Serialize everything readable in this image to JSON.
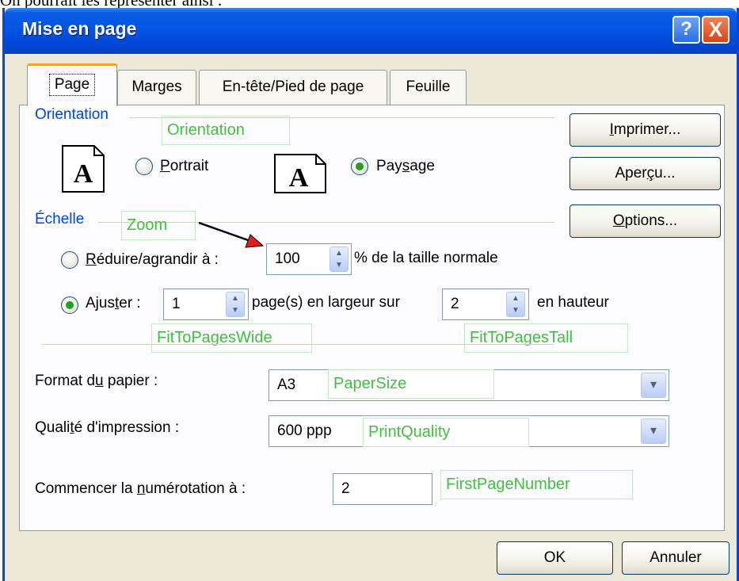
{
  "caption": "On pourrait les représenter ainsi :",
  "window": {
    "title": "Mise en page",
    "help_symbol": "?",
    "close_symbol": "X"
  },
  "tabs": [
    {
      "label": "Page",
      "active": true
    },
    {
      "label": "Marges",
      "active": false
    },
    {
      "label": "En-tête/Pied de page",
      "active": false
    },
    {
      "label": "Feuille",
      "active": false
    }
  ],
  "orientation": {
    "group_label": "Orientation",
    "annotation": "Orientation",
    "portrait_pre": "",
    "portrait_key": "P",
    "portrait_post": "ortrait",
    "landscape_pre": "Pay",
    "landscape_key": "s",
    "landscape_post": "age",
    "selected": "landscape",
    "icon_letter": "A"
  },
  "scale": {
    "group_label": "Échelle",
    "annotation": "Zoom",
    "reduce_pre": "",
    "reduce_key": "R",
    "reduce_post": "éduire/agrandir à :",
    "zoom_value": "100",
    "zoom_suffix": "% de la taille normale",
    "fit_pre": "Ajus",
    "fit_key": "t",
    "fit_post": "er :",
    "pages_wide": "1",
    "pages_wide_label": "page(s) en largeur sur",
    "pages_tall": "2",
    "pages_tall_label": "en hauteur",
    "annotation_wide": "FitToPagesWide",
    "annotation_tall": "FitToPagesTall",
    "selected": "fit"
  },
  "paper": {
    "label_pre": "Format d",
    "label_key": "u",
    "label_post": " papier :",
    "value": "A3",
    "annotation": "PaperSize"
  },
  "quality": {
    "label_pre": "Quali",
    "label_key": "t",
    "label_post": "é d'impression :",
    "value": "600 ppp",
    "annotation": "PrintQuality"
  },
  "first_page": {
    "label_pre": "Commencer la ",
    "label_key": "n",
    "label_post": "umérotation à :",
    "value": "2",
    "annotation": "FirstPageNumber"
  },
  "side_buttons": {
    "print_key": "I",
    "print_rest": "mprimer...",
    "preview_pre": "Aper",
    "preview_key": "ç",
    "preview_post": "u...",
    "options_key": "O",
    "options_rest": "ptions..."
  },
  "footer": {
    "ok": "OK",
    "cancel": "Annuler"
  },
  "colors": {
    "titlebar": "#0554e3",
    "group_label": "#0046d5",
    "annotation": "#40c040",
    "arrow": "#e81c1c",
    "radio_dot": "#21a121"
  }
}
